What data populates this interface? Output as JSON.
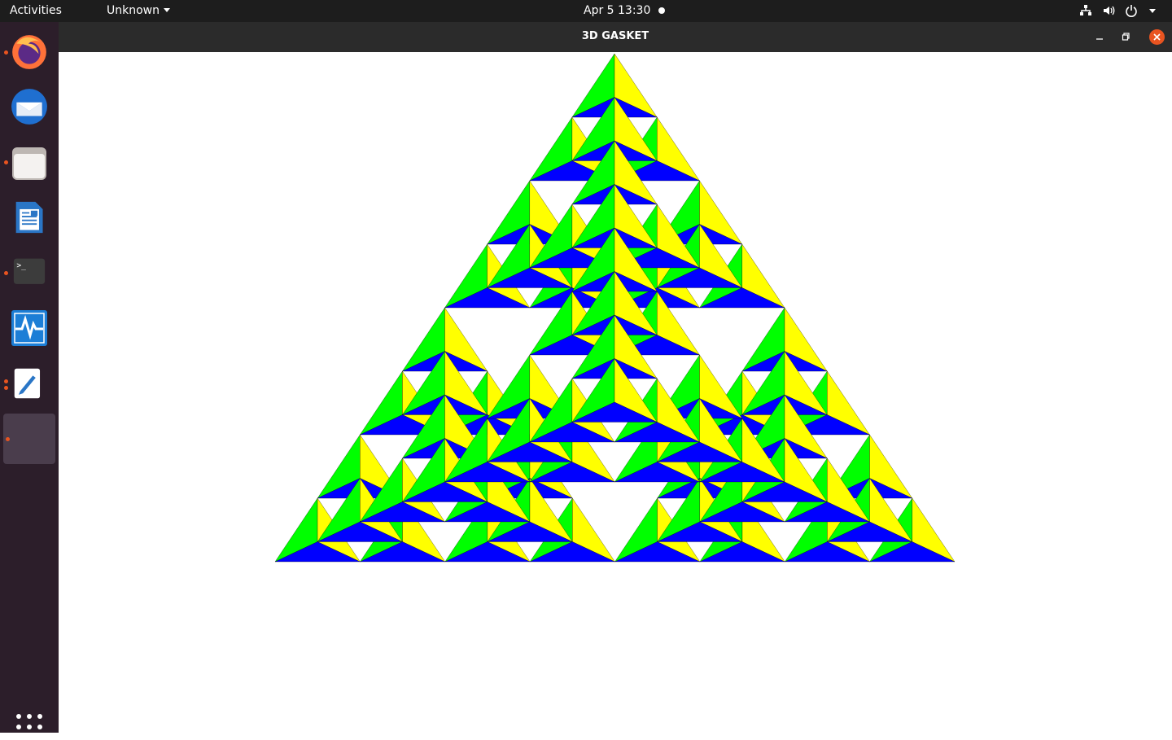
{
  "topbar": {
    "activities_label": "Activities",
    "app_menu_label": "Unknown",
    "clock": "Apr 5  13:30",
    "tray_icons": [
      "network-icon",
      "volume-icon",
      "power-icon",
      "chevron-down-icon"
    ]
  },
  "dock": {
    "items": [
      {
        "name": "firefox",
        "icon": "firefox-icon",
        "running": true
      },
      {
        "name": "thunderbird",
        "icon": "mail-icon",
        "running": false
      },
      {
        "name": "files",
        "icon": "folder-icon",
        "running": true
      },
      {
        "name": "writer",
        "icon": "document-icon",
        "running": false
      },
      {
        "name": "terminal",
        "icon": "terminal-icon",
        "running": true
      },
      {
        "name": "system-monitor",
        "icon": "monitor-icon",
        "running": false
      },
      {
        "name": "text-editor",
        "icon": "text-editor-icon",
        "running": true
      },
      {
        "name": "gasket-app",
        "icon": "app-icon",
        "running": true
      }
    ],
    "show_apps_icon": "grid-icon"
  },
  "window": {
    "title": "3D GASKET",
    "buttons": [
      "minimize-icon",
      "maximize-icon",
      "close-icon"
    ]
  },
  "gasket": {
    "levels": 3,
    "colors": {
      "left": "#00ff00",
      "right": "#ffff00",
      "base": "#0000ff",
      "background": "#ffffff",
      "edge": "#000000"
    }
  }
}
